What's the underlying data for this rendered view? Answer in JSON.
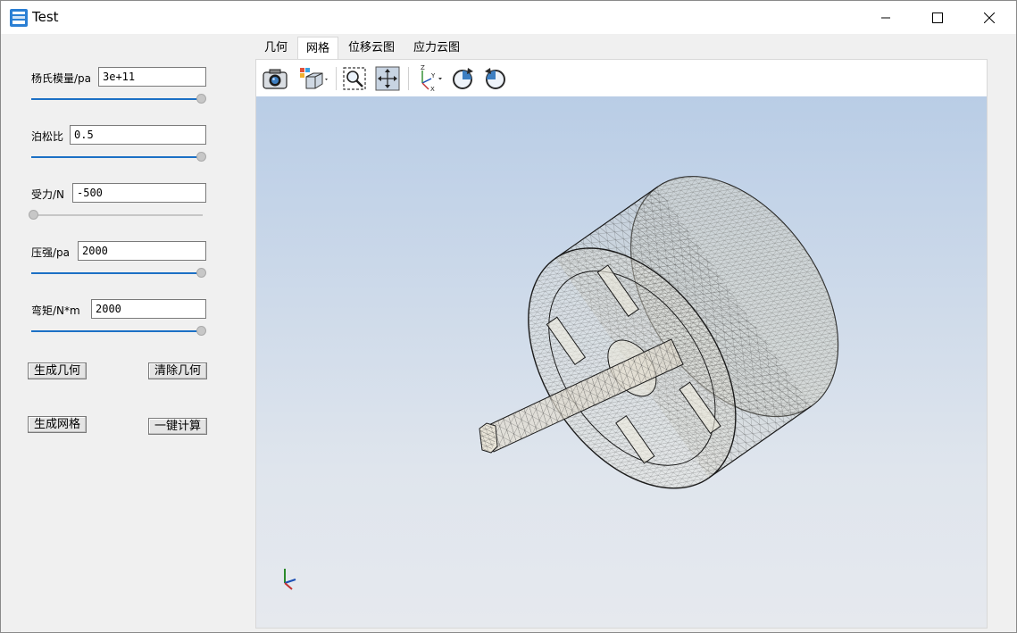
{
  "window": {
    "title": "Test"
  },
  "params": [
    {
      "label": "杨氏模量/pa",
      "value": "3e+11",
      "slider_level": 1.0
    },
    {
      "label": "泊松比",
      "value": "0.5",
      "slider_level": 1.0
    },
    {
      "label": "受力/N",
      "value": "-500",
      "slider_level": 0.0
    },
    {
      "label": "压强/pa",
      "value": "2000",
      "slider_level": 1.0
    },
    {
      "label": "弯矩/N*m",
      "value": "2000",
      "slider_level": 1.0
    }
  ],
  "buttons": {
    "generate_geometry": "生成几何",
    "clear_geometry": "清除几何",
    "generate_mesh": "生成网格",
    "one_click_compute": "一键计算"
  },
  "tabs": [
    "几何",
    "网格",
    "位移云图",
    "应力云图"
  ],
  "active_tab": "网格",
  "toolbar": [
    "camera-icon",
    "view-cube-icon",
    "zoom-window-icon",
    "pan-icon",
    "axes-icon",
    "rotate-cw-icon",
    "rotate-ccw-icon"
  ],
  "colors": {
    "accent": "#1c70c5",
    "viewport_top": "#b9cde6",
    "viewport_bottom": "#e6e9ee"
  }
}
